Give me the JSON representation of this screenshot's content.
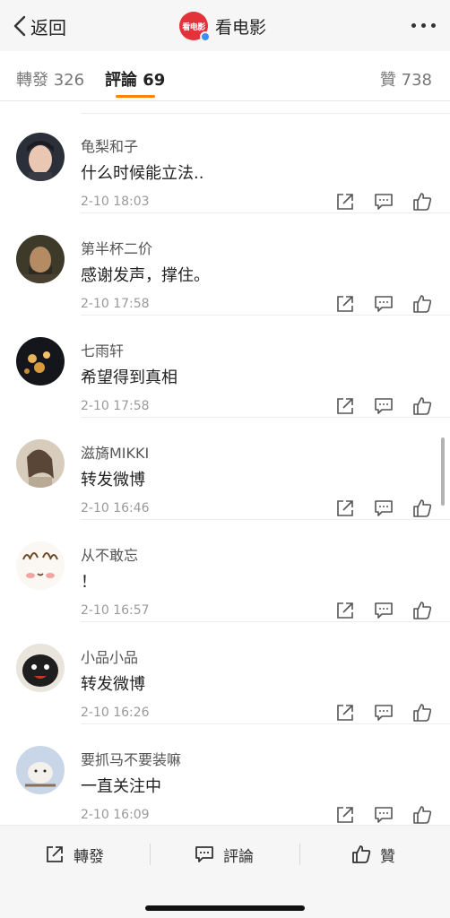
{
  "header": {
    "back_label": "返回",
    "title": "看电影",
    "logo_text": "看电影",
    "verified_color": "#3b8ff5",
    "brand_color": "#e2333a"
  },
  "tabs": {
    "forward": "轉發 326",
    "comment": "評論 69",
    "like": "贊 738",
    "accent_color": "#ff8200"
  },
  "comments": [
    {
      "name": "龟梨和子",
      "text": "什么时候能立法..",
      "time": "2-10 18:03"
    },
    {
      "name": "第半杯二价",
      "text": "感谢发声，撑住。",
      "time": "2-10 17:58"
    },
    {
      "name": "七雨轩",
      "text": "希望得到真相",
      "time": "2-10 17:58"
    },
    {
      "name": "滋旖MIKKI",
      "text": "转发微博",
      "time": "2-10 16:46"
    },
    {
      "name": "从不敢忘",
      "text": "！",
      "time": "2-10 16:57"
    },
    {
      "name": "小品小品",
      "text": "转发微博",
      "time": "2-10 16:26"
    },
    {
      "name": "要抓马不要装嘛",
      "text": "一直关注中",
      "time": "2-10 16:09"
    }
  ],
  "bottom_bar": {
    "forward": "轉發",
    "comment": "評論",
    "like": "贊"
  },
  "icons": {
    "back": "chevron-left-icon",
    "more": "more-dots-icon",
    "share": "share-icon",
    "comment": "comment-icon",
    "like": "thumbs-up-icon"
  }
}
